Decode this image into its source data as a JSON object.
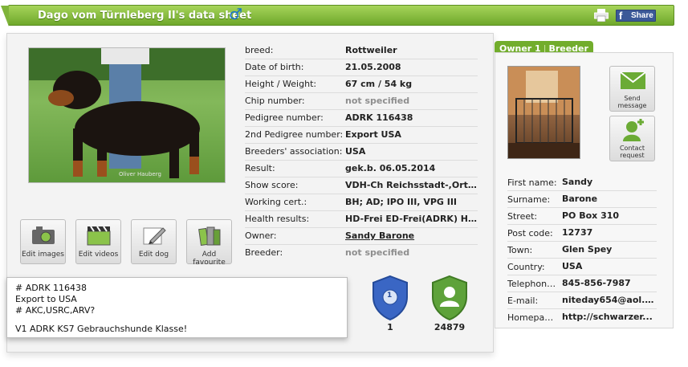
{
  "header": {
    "title": "Dago vom Türnleberg II's data sheet",
    "gender_icon": "male-icon",
    "print_icon": "print-icon",
    "share": {
      "icon": "facebook-icon",
      "letter": "f",
      "label": "Share"
    }
  },
  "colors": {
    "header_green": "#7fb33a",
    "tab_green": "#72ad2c",
    "male_blue": "#1a73c9",
    "facebook_blue": "#3b5998"
  },
  "photo_watermark": "Oliver Hauberg",
  "actions": [
    {
      "label": "Edit images",
      "icon": "camera-icon"
    },
    {
      "label": "Edit videos",
      "icon": "clapperboard-icon"
    },
    {
      "label": "Edit dog",
      "icon": "pencil-icon"
    },
    {
      "label": "Add favourite",
      "icon": "books-icon"
    }
  ],
  "details": [
    {
      "key": "breed:",
      "value": "Rottweiler"
    },
    {
      "key": "Date of birth:",
      "value": "21.05.2008"
    },
    {
      "key": "Height / Weight:",
      "value": "67 cm / 54 kg"
    },
    {
      "key": "Chip number:",
      "value": "not specified"
    },
    {
      "key": "Pedigree number:",
      "value": "ADRK 116438"
    },
    {
      "key": "2nd Pedigree number:",
      "value": "Export USA"
    },
    {
      "key": "Breeders' association:",
      "value": "USA"
    },
    {
      "key": "Result:",
      "value": "gek.b. 06.05.2014"
    },
    {
      "key": "Show score:",
      "value": "VDH-Ch Reichsstadt-,Orten..."
    },
    {
      "key": "Working cert.:",
      "value": "BH; AD; IPO III, VPG III"
    },
    {
      "key": "Health results:",
      "value": "HD-Frei ED-Frei(ADRK) He..."
    },
    {
      "key": "Owner:",
      "value": "Sandy Barone"
    },
    {
      "key": "Breeder:",
      "value": "not specified"
    }
  ],
  "notes": {
    "lines": [
      "# ADRK 116438",
      "Export to USA",
      "# AKC,USRC,ARV?",
      "",
      "V1 ADRK KS7 Gebrauchshunde Klasse!"
    ]
  },
  "badges": [
    {
      "icon": "rank-shield-icon",
      "number": "1",
      "count": "1"
    },
    {
      "icon": "user-shield-icon",
      "count": "24879"
    }
  ],
  "owner_tabs": {
    "owner": "Owner 1",
    "separator": "|",
    "breeder": "Breeder"
  },
  "contact_buttons": {
    "send": {
      "label_1": "Send",
      "label_2": "message",
      "icon": "envelope-icon"
    },
    "request": {
      "label_1": "Contact",
      "label_2": "request",
      "icon": "add-contact-icon"
    }
  },
  "owner": [
    {
      "key": "First name:",
      "value": "Sandy"
    },
    {
      "key": "Surname:",
      "value": "Barone"
    },
    {
      "key": "Street:",
      "value": "PO Box 310"
    },
    {
      "key": "Post code:",
      "value": "12737"
    },
    {
      "key": "Town:",
      "value": "Glen Spey"
    },
    {
      "key": "Country:",
      "value": "USA"
    },
    {
      "key": "Telephone ...",
      "value": "845-856-7987"
    },
    {
      "key": "E-mail:",
      "value": "niteday654@aol.com"
    },
    {
      "key": "Homepage:",
      "value": "http://schwarzer..."
    }
  ]
}
